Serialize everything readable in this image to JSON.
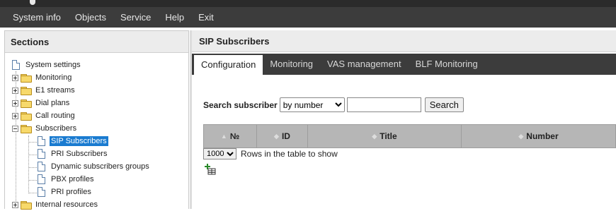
{
  "menu": {
    "items": [
      "System info",
      "Objects",
      "Service",
      "Help",
      "Exit"
    ]
  },
  "sections": {
    "title": "Sections",
    "tree": [
      {
        "label": "System settings",
        "type": "page"
      },
      {
        "label": "Monitoring",
        "type": "folder"
      },
      {
        "label": "E1 streams",
        "type": "folder"
      },
      {
        "label": "Dial plans",
        "type": "folder"
      },
      {
        "label": "Call routing",
        "type": "folder"
      },
      {
        "label": "Subscribers",
        "type": "folder"
      },
      {
        "label": "SIP Subscribers",
        "type": "page"
      },
      {
        "label": "PRI Subscribers",
        "type": "page"
      },
      {
        "label": "Dynamic subscribers groups",
        "type": "page"
      },
      {
        "label": "PBX profiles",
        "type": "page"
      },
      {
        "label": "PRI profiles",
        "type": "page"
      },
      {
        "label": "Internal resources",
        "type": "folder"
      }
    ]
  },
  "content": {
    "title": "SIP Subscribers",
    "tabs": [
      "Configuration",
      "Monitoring",
      "VAS management",
      "BLF Monitoring"
    ],
    "active_tab": "Configuration",
    "search": {
      "label": "Search subscriber",
      "mode": "by number",
      "value": "",
      "button": "Search"
    },
    "grid": {
      "columns": [
        "№",
        "ID",
        "Title",
        "Number"
      ]
    },
    "rows_per_page": {
      "value": "1000",
      "label": "Rows in the table to show"
    },
    "add_icon": "add-row-icon"
  },
  "colors": {
    "menubar": "#3c3c3c",
    "selected": "#1a7bd0",
    "grid_header": "#b6b6b6"
  }
}
